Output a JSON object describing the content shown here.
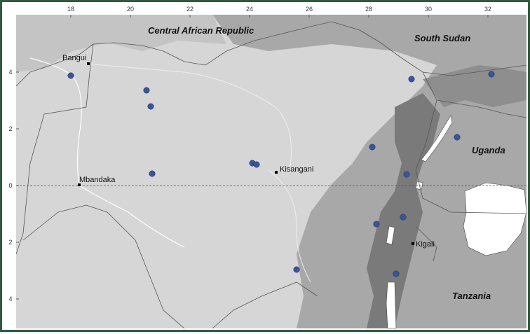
{
  "map": {
    "x_ticks": [
      "18",
      "20",
      "22",
      "24",
      "26",
      "28",
      "30",
      "32"
    ],
    "y_ticks": [
      "4",
      "2",
      "0",
      "2",
      "4"
    ],
    "countries": [
      "Central African Republic",
      "South Sudan",
      "Uganda",
      "Tanzania"
    ],
    "cities": [
      "Bangui",
      "Mbandaka",
      "Kisangani",
      "Kigali"
    ],
    "site_count": 15,
    "colors": {
      "frame": "#2f5a3e",
      "lowland": "#d9d9d9",
      "highland": "#8a8a8a",
      "water": "#ffffff",
      "marker": "#3a5599"
    }
  }
}
